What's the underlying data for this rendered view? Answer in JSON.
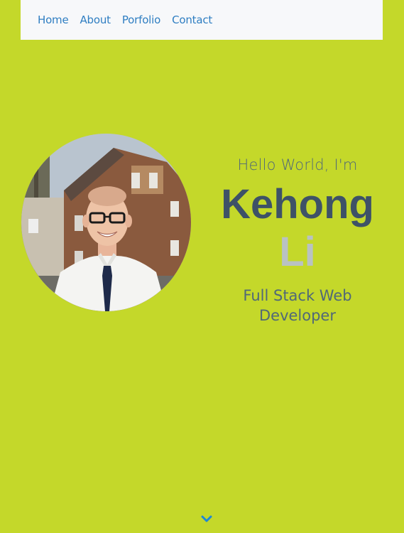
{
  "nav": {
    "items": [
      {
        "label": "Home"
      },
      {
        "label": "About"
      },
      {
        "label": "Porfolio"
      },
      {
        "label": "Contact"
      }
    ]
  },
  "hero": {
    "greeting": "Hello World, I'm",
    "first_name": "Kehong",
    "last_name": "Li",
    "role": "Full Stack Web Developer"
  },
  "icons": {
    "scroll": "chevron-down-icon"
  },
  "colors": {
    "background": "#c4d82a",
    "nav_background": "#f7f8fa",
    "nav_link": "#2f7ec2",
    "first_name": "#3e5267",
    "last_name": "#b9c2c2",
    "chevron": "#1e88d6"
  }
}
